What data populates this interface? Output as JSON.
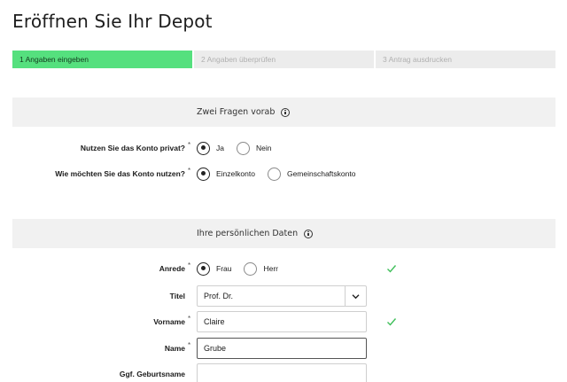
{
  "page": {
    "title": "Eröffnen Sie Ihr Depot"
  },
  "stepper": {
    "steps": [
      {
        "label": "1 Angaben eingeben",
        "active": true
      },
      {
        "label": "2 Angaben überprüfen",
        "active": false
      },
      {
        "label": "3 Antrag ausdrucken",
        "active": false
      }
    ]
  },
  "sections": {
    "questions": {
      "title": "Zwei Fragen vorab"
    },
    "personal": {
      "title": "Ihre persönlichen Daten"
    }
  },
  "required_marker": "*",
  "form": {
    "private": {
      "label": "Nutzen Sie das Konto privat?",
      "options": [
        "Ja",
        "Nein"
      ],
      "selected": "Ja"
    },
    "usage": {
      "label": "Wie möchten Sie das Konto nutzen?",
      "options": [
        "Einzelkonto",
        "Gemeinschaftskonto"
      ],
      "selected": "Einzelkonto"
    },
    "anrede": {
      "label": "Anrede",
      "options": [
        "Frau",
        "Herr"
      ],
      "selected": "Frau"
    },
    "titel": {
      "label": "Titel",
      "value": "Prof. Dr."
    },
    "vorname": {
      "label": "Vorname",
      "value": "Claire"
    },
    "name": {
      "label": "Name",
      "value": "Grube"
    },
    "geburtsname": {
      "label": "Ggf. Geburtsname",
      "value": ""
    }
  },
  "colors": {
    "active_step": "#55e07e",
    "check": "#3fbf5a"
  },
  "icons": {
    "info": "info-icon",
    "valid": "checkmark-icon",
    "dropdown": "chevron-down-icon"
  }
}
